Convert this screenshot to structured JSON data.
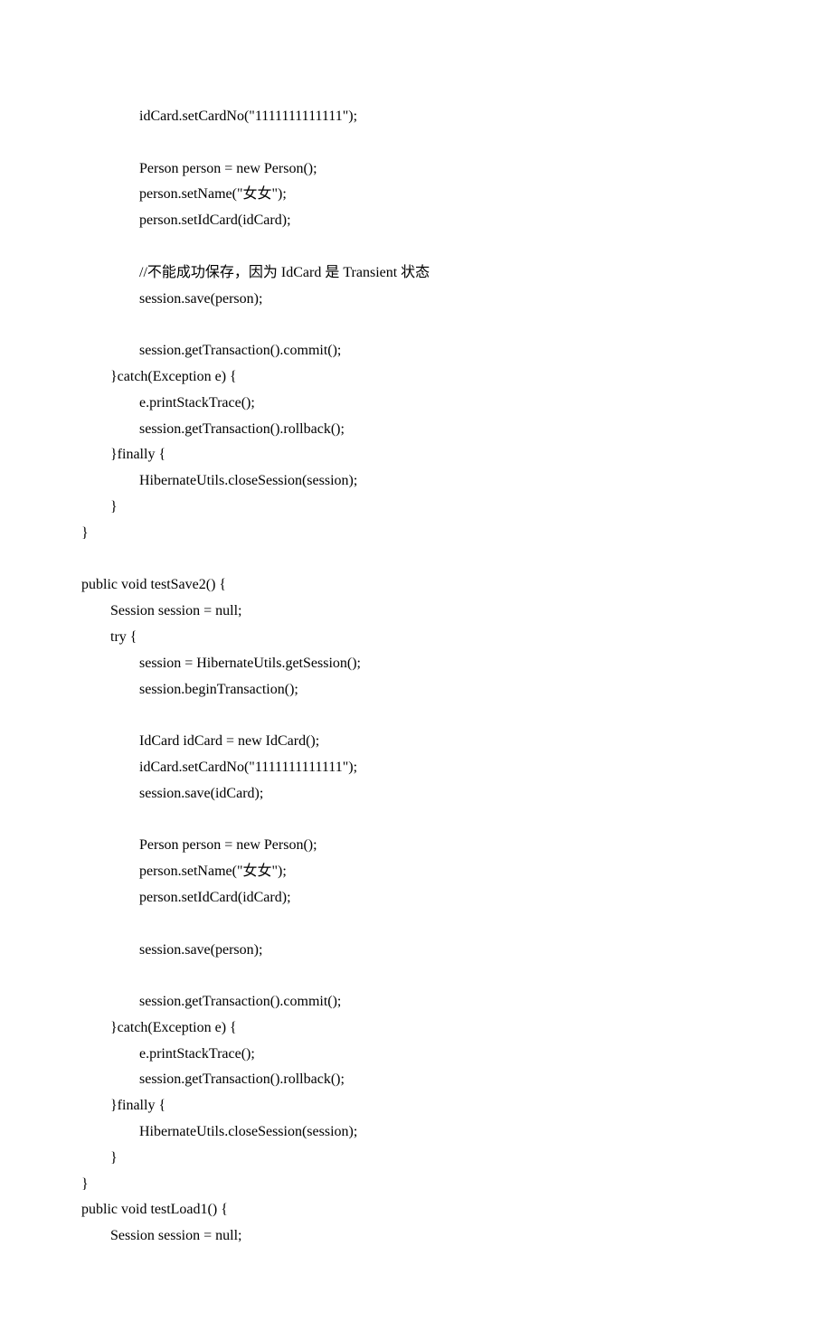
{
  "code": {
    "lines": [
      "                idCard.setCardNo(\"1111111111111\");",
      "                ",
      "                Person person = new Person();",
      "                person.setName(\"女女\");",
      "                person.setIdCard(idCard);",
      "                ",
      "                //不能成功保存，因为 IdCard 是 Transient 状态",
      "                session.save(person);",
      "                ",
      "                session.getTransaction().commit();",
      "        }catch(Exception e) {",
      "                e.printStackTrace();",
      "                session.getTransaction().rollback();",
      "        }finally {",
      "                HibernateUtils.closeSession(session);",
      "        }",
      "}",
      "",
      "public void testSave2() {",
      "        Session session = null;",
      "        try {",
      "                session = HibernateUtils.getSession();",
      "                session.beginTransaction();",
      "                ",
      "                IdCard idCard = new IdCard();",
      "                idCard.setCardNo(\"1111111111111\");",
      "                session.save(idCard);",
      "                ",
      "                Person person = new Person();",
      "                person.setName(\"女女\");",
      "                person.setIdCard(idCard);",
      "                ",
      "                session.save(person);",
      "                ",
      "                session.getTransaction().commit();",
      "        }catch(Exception e) {",
      "                e.printStackTrace();",
      "                session.getTransaction().rollback();",
      "        }finally {",
      "                HibernateUtils.closeSession(session);",
      "        }",
      "}",
      "public void testLoad1() {",
      "        Session session = null;"
    ]
  }
}
